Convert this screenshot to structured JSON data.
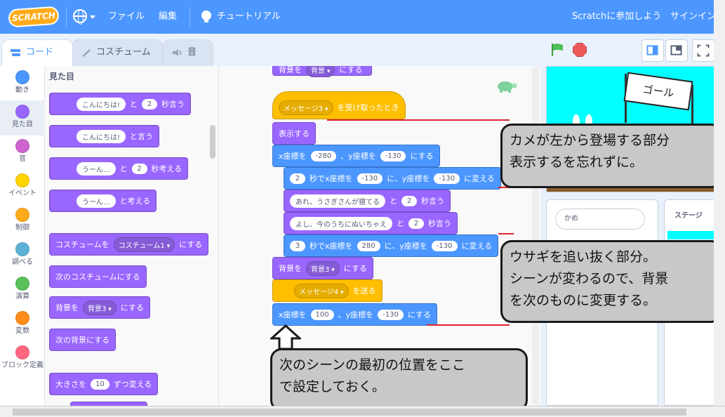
{
  "menubar": {
    "logo": "SCRATCH",
    "file": "ファイル",
    "edit": "編集",
    "tutorial": "チュートリアル",
    "join": "Scratchに参加しよう",
    "signin": "サインイン"
  },
  "tabs": {
    "code": "コード",
    "costumes": "コスチューム",
    "sounds": "音"
  },
  "categories": [
    {
      "label": "動き",
      "color": "#4c97ff"
    },
    {
      "label": "見た目",
      "color": "#9966ff"
    },
    {
      "label": "音",
      "color": "#cf63cf"
    },
    {
      "label": "イベント",
      "color": "#ffd500"
    },
    {
      "label": "制御",
      "color": "#ffab19"
    },
    {
      "label": "調べる",
      "color": "#5cb1d6"
    },
    {
      "label": "演算",
      "color": "#59c059"
    },
    {
      "label": "変数",
      "color": "#ff8c1a"
    },
    {
      "label": "ブロック定義",
      "color": "#ff6680"
    }
  ],
  "palette": {
    "title": "見た目",
    "say_for": {
      "text": "こんにちは!",
      "and": "と",
      "secs": "2",
      "suffix": "秒言う"
    },
    "say": {
      "text": "こんにちは!",
      "suffix": "と言う"
    },
    "think_for": {
      "text": "うーん...",
      "and": "と",
      "secs": "2",
      "suffix": "秒考える"
    },
    "think": {
      "text": "うーん...",
      "suffix": "と考える"
    },
    "switch_costume": {
      "prefix": "コスチュームを",
      "value": "コスチューム1",
      "suffix": "にする"
    },
    "next_costume": "次のコスチュームにする",
    "switch_backdrop": {
      "prefix": "背景を",
      "value": "背景3",
      "suffix": "にする"
    },
    "next_backdrop": "次の背景にする",
    "change_size": {
      "prefix": "大きさを",
      "value": "10",
      "suffix": "ずつ変える"
    }
  },
  "script": {
    "top_partial": {
      "prefix": "背景を",
      "value": "背景",
      "suffix": "にする"
    },
    "hat": {
      "value": "メッセージ3",
      "suffix": "を受け取ったとき"
    },
    "show": "表示する",
    "goto1": {
      "a": "x座標を",
      "x": "-280",
      "b": "、y座標を",
      "y": "-130",
      "c": "にする"
    },
    "glide1": {
      "secs": "2",
      "a": "秒でx座標を",
      "x": "-130",
      "b": "に、y座標を",
      "y": "-130",
      "c": "に変える"
    },
    "say1": {
      "text": "あれ、うさぎさんが寝てる",
      "and": "と",
      "secs": "2",
      "suffix": "秒言う"
    },
    "say2": {
      "text": "よし、今のうちにぬいちゃえ",
      "and": "と",
      "secs": "2",
      "suffix": "秒言う"
    },
    "glide2": {
      "secs": "3",
      "a": "秒でx座標を",
      "x": "280",
      "b": "に、y座標を",
      "y": "-130",
      "c": "に変える"
    },
    "backdrop": {
      "prefix": "背景を",
      "value": "背景3",
      "suffix": "にする"
    },
    "broadcast": {
      "value": "メッセージ4",
      "suffix": "を送る"
    },
    "goto2": {
      "a": "x座標を",
      "x": "100",
      "b": "、y座標を",
      "y": "-130",
      "c": "にする"
    }
  },
  "stage": {
    "goal_text": "ゴール",
    "sprite_name": "かめ",
    "stage_label": "ステージ"
  },
  "callouts": {
    "c1_line1": "カメが左から登場する部分",
    "c1_line2": "表示するを忘れずに。",
    "c2_line1": "ウサギを追い抜く部分。",
    "c2_line2": "シーンが変わるので、背景",
    "c2_line3": "を次のものに変更する。",
    "c3_line1": "次のシーンの最初の位置をここ",
    "c3_line2": "で設定しておく。"
  },
  "colors": {
    "menubar": "#4c97ff",
    "looks": "#9966ff",
    "motion": "#4c97ff",
    "events": "#ffbf00",
    "annotation_red": "#e0242c"
  }
}
